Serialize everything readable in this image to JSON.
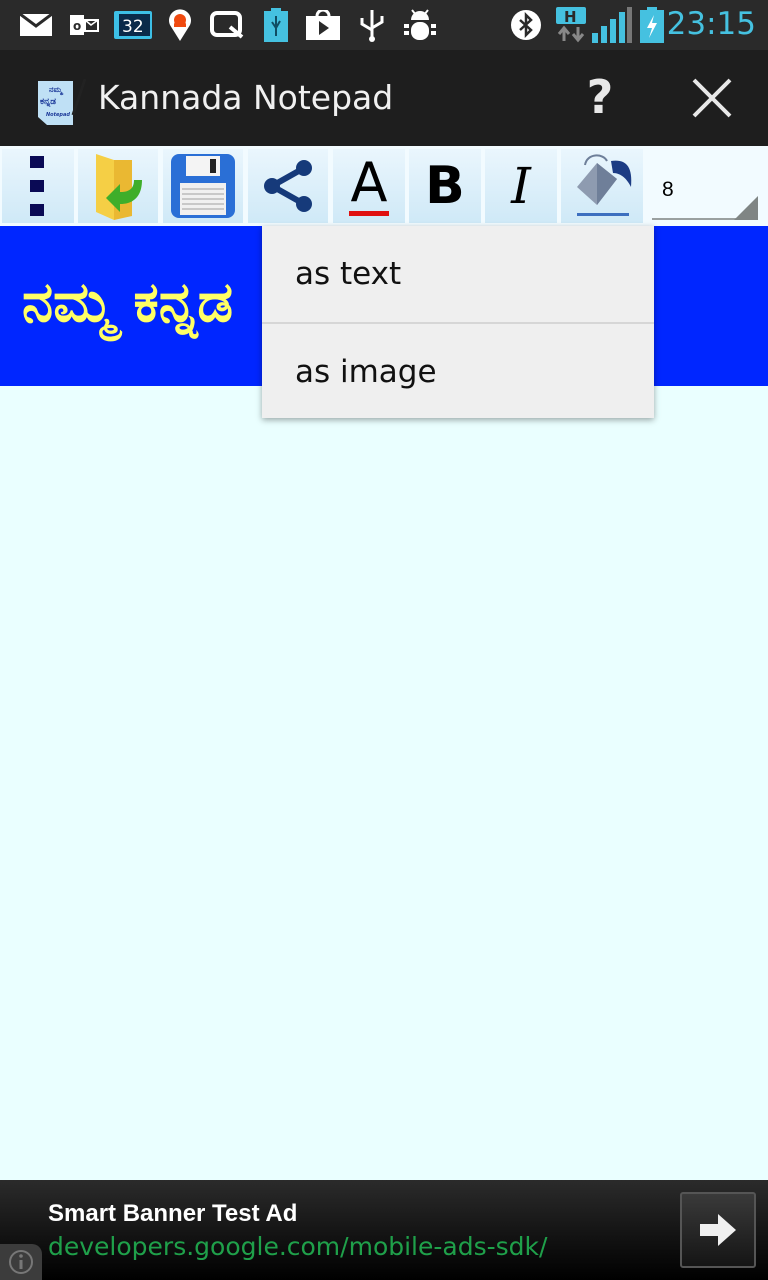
{
  "status_bar": {
    "time": "23:15",
    "calendar_day": "32",
    "network_type": "H",
    "icons": [
      "mail-icon",
      "outlook-icon",
      "calendar-icon",
      "maps-pin-icon",
      "search-icon",
      "usb-battery-icon",
      "play-store-icon",
      "usb-icon",
      "debug-icon",
      "bluetooth-icon",
      "network-h-icon",
      "signal-icon",
      "battery-charging-icon"
    ]
  },
  "action_bar": {
    "title": "Kannada Notepad",
    "logo_text_top": "ನಮ್ಮ",
    "logo_text_mid": "ಕನ್ನಡ",
    "logo_text_bottom": "Notepad",
    "help_label": "?"
  },
  "toolbar": {
    "buttons": [
      "overflow-menu",
      "open-file",
      "save",
      "share",
      "font-color",
      "bold",
      "italic",
      "background-color"
    ],
    "bold_label": "B",
    "italic_label": "I",
    "font_color_label": "A",
    "font_size": "8"
  },
  "banner": {
    "text": "ನಮ್ಮ ಕನ್ನಡ",
    "background_color": "#0026ff",
    "text_color": "#ffff66"
  },
  "share_menu": {
    "items": [
      {
        "label": "as text"
      },
      {
        "label": "as image"
      }
    ]
  },
  "ad": {
    "title": "Smart Banner Test Ad",
    "url": "developers.google.com/mobile-ads-sdk/"
  }
}
